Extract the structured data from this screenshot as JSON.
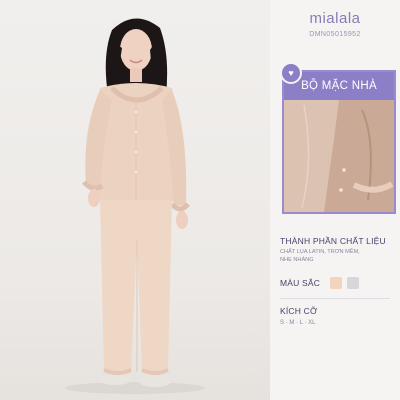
{
  "brand": {
    "name": "mialala",
    "sku": "DMN05015952"
  },
  "feature": {
    "label": "BỘ MẶC NHÀ",
    "icon": "heart-icon"
  },
  "material": {
    "title": "THÀNH PHẦN CHẤT LIỆU",
    "lines": [
      "CHẤT LỤA LATIN, TRƠN MỀM,",
      "NHẸ NHÀNG"
    ]
  },
  "colors": {
    "title": "MÀU SẮC",
    "swatches": [
      {
        "name": "peach",
        "hex": "#f2d4bf"
      },
      {
        "name": "light-gray",
        "hex": "#d7d7da"
      }
    ]
  },
  "size": {
    "title": "KÍCH CỠ",
    "options": "S · M · L · XL"
  },
  "palette": {
    "accent": "#8d7ec8",
    "brand": "#8a7bb3",
    "heading": "#4a3f6a"
  }
}
